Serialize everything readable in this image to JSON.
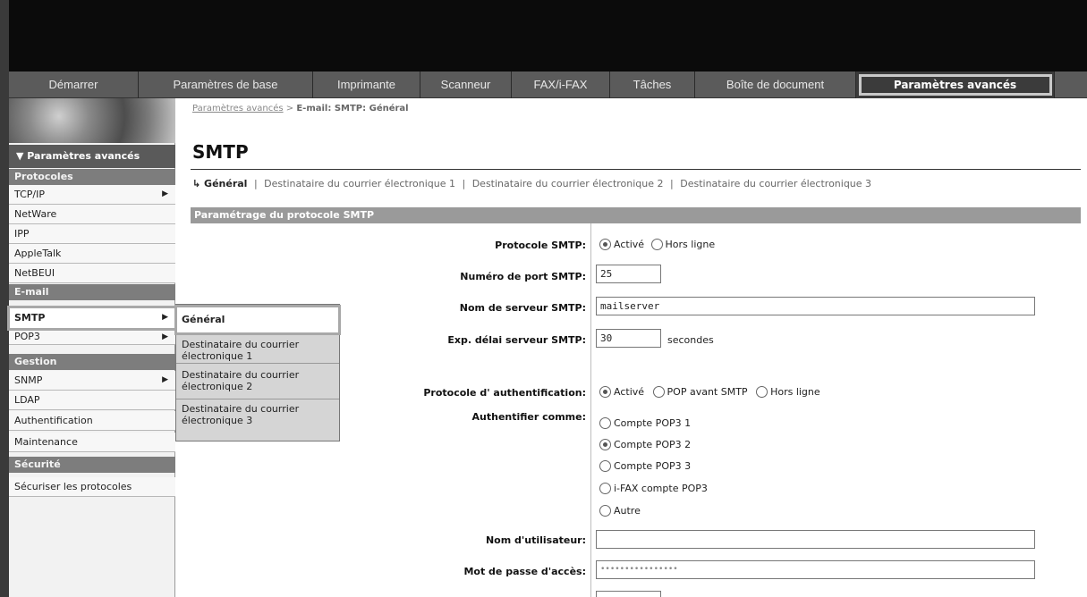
{
  "tabs": [
    {
      "label": "Démarrer"
    },
    {
      "label": "Paramètres de base"
    },
    {
      "label": "Imprimante"
    },
    {
      "label": "Scanneur"
    },
    {
      "label": "FAX/i-FAX"
    },
    {
      "label": "Tâches"
    },
    {
      "label": "Boîte de document"
    },
    {
      "label": "Paramètres avancés"
    }
  ],
  "sidebar": {
    "title": "▼ Paramètres avancés",
    "sections": {
      "protocoles": "Protocoles",
      "courrier": "E-mail",
      "gestion": "Gestion",
      "securite": "Sécurité"
    },
    "items": {
      "tcpip": "TCP/IP",
      "netware": "NetWare",
      "ipp": "IPP",
      "appletalk": "AppleTalk",
      "netbeui": "NetBEUI",
      "smtp": "SMTP",
      "pop3": "POP3",
      "snmp": "SNMP",
      "ldap": "LDAP",
      "auth": "Authentification",
      "maintenance": "Maintenance",
      "securiser": "Sécuriser les protocoles"
    }
  },
  "flyout": {
    "items": [
      "Général",
      "Destinataire du courrier électronique 1",
      "Destinataire du courrier électronique 2",
      "Destinataire du courrier électronique 3"
    ]
  },
  "breadcrumb": {
    "link": "Paramètres avancés",
    "separator": ">",
    "current": "E-mail: SMTP: Général"
  },
  "page": {
    "title": "SMTP",
    "subnav": {
      "current": "↳ Général",
      "links": [
        "Destinataire du courrier électronique 1",
        "Destinataire du courrier électronique 2",
        "Destinataire du courrier électronique 3"
      ]
    },
    "section_title": "Paramétrage du protocole SMTP"
  },
  "form": {
    "smtp_protocol": {
      "label": "Protocole SMTP:",
      "options": [
        "Activé",
        "Hors ligne"
      ],
      "selected": "Activé"
    },
    "port": {
      "label": "Numéro de port SMTP:",
      "value": "25"
    },
    "server": {
      "label": "Nom de serveur SMTP:",
      "value": "mailserver"
    },
    "timeout": {
      "label": "Exp. délai serveur SMTP:",
      "value": "30",
      "unit": "secondes"
    },
    "auth_protocol": {
      "label": "Protocole d' authentification:",
      "options": [
        "Activé",
        "POP avant SMTP",
        "Hors ligne"
      ],
      "selected": "Activé"
    },
    "auth_as": {
      "label": "Authentifier comme:",
      "options": [
        "Compte POP3 1",
        "Compte POP3 2",
        "Compte POP3 3",
        "i-FAX compte POP3",
        "Autre"
      ],
      "selected": "Compte POP3 2"
    },
    "username": {
      "label": "Nom d'utilisateur:",
      "value": ""
    },
    "password": {
      "label": "Mot de passe d'accès:",
      "value": "••••••••••••••••"
    }
  }
}
